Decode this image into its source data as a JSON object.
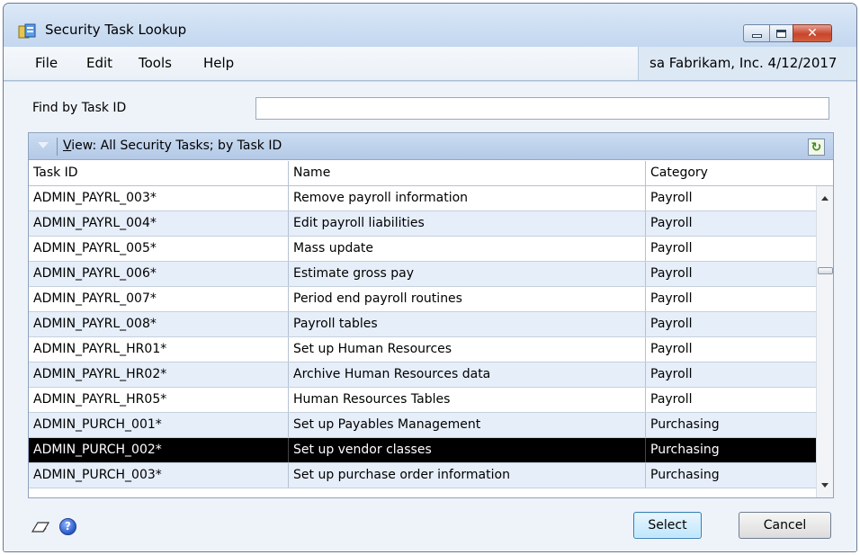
{
  "window": {
    "title": "Security Task Lookup",
    "close_glyph": "✕"
  },
  "menu": {
    "items": [
      "File",
      "Edit",
      "Tools",
      "Help"
    ],
    "company_info": "sa  Fabrikam, Inc.  4/12/2017"
  },
  "find": {
    "label": "Find by Task ID",
    "value": ""
  },
  "view": {
    "prefix": "V",
    "label": "iew: All Security Tasks; by Task ID"
  },
  "table": {
    "columns": [
      "Task ID",
      "Name",
      "Category"
    ],
    "rows": [
      {
        "task_id": "ADMIN_PAYRL_003*",
        "name": "Remove payroll information",
        "category": "Payroll"
      },
      {
        "task_id": "ADMIN_PAYRL_004*",
        "name": "Edit payroll liabilities",
        "category": "Payroll"
      },
      {
        "task_id": "ADMIN_PAYRL_005*",
        "name": "Mass update",
        "category": "Payroll"
      },
      {
        "task_id": "ADMIN_PAYRL_006*",
        "name": "Estimate gross pay",
        "category": "Payroll"
      },
      {
        "task_id": "ADMIN_PAYRL_007*",
        "name": "Period end payroll routines",
        "category": "Payroll"
      },
      {
        "task_id": "ADMIN_PAYRL_008*",
        "name": "Payroll tables",
        "category": "Payroll"
      },
      {
        "task_id": "ADMIN_PAYRL_HR01*",
        "name": "Set up Human Resources",
        "category": "Payroll"
      },
      {
        "task_id": "ADMIN_PAYRL_HR02*",
        "name": "Archive Human Resources data",
        "category": "Payroll"
      },
      {
        "task_id": "ADMIN_PAYRL_HR05*",
        "name": "Human Resources Tables",
        "category": "Payroll"
      },
      {
        "task_id": "ADMIN_PURCH_001*",
        "name": "Set up Payables Management",
        "category": "Purchasing"
      },
      {
        "task_id": "ADMIN_PURCH_002*",
        "name": "Set up vendor classes",
        "category": "Purchasing",
        "selected": true
      },
      {
        "task_id": "ADMIN_PURCH_003*",
        "name": "Set up purchase order information",
        "category": "Purchasing"
      }
    ]
  },
  "footer": {
    "select_label": "Select",
    "cancel_label": "Cancel",
    "help_glyph": "?",
    "refresh_glyph": "↻"
  }
}
